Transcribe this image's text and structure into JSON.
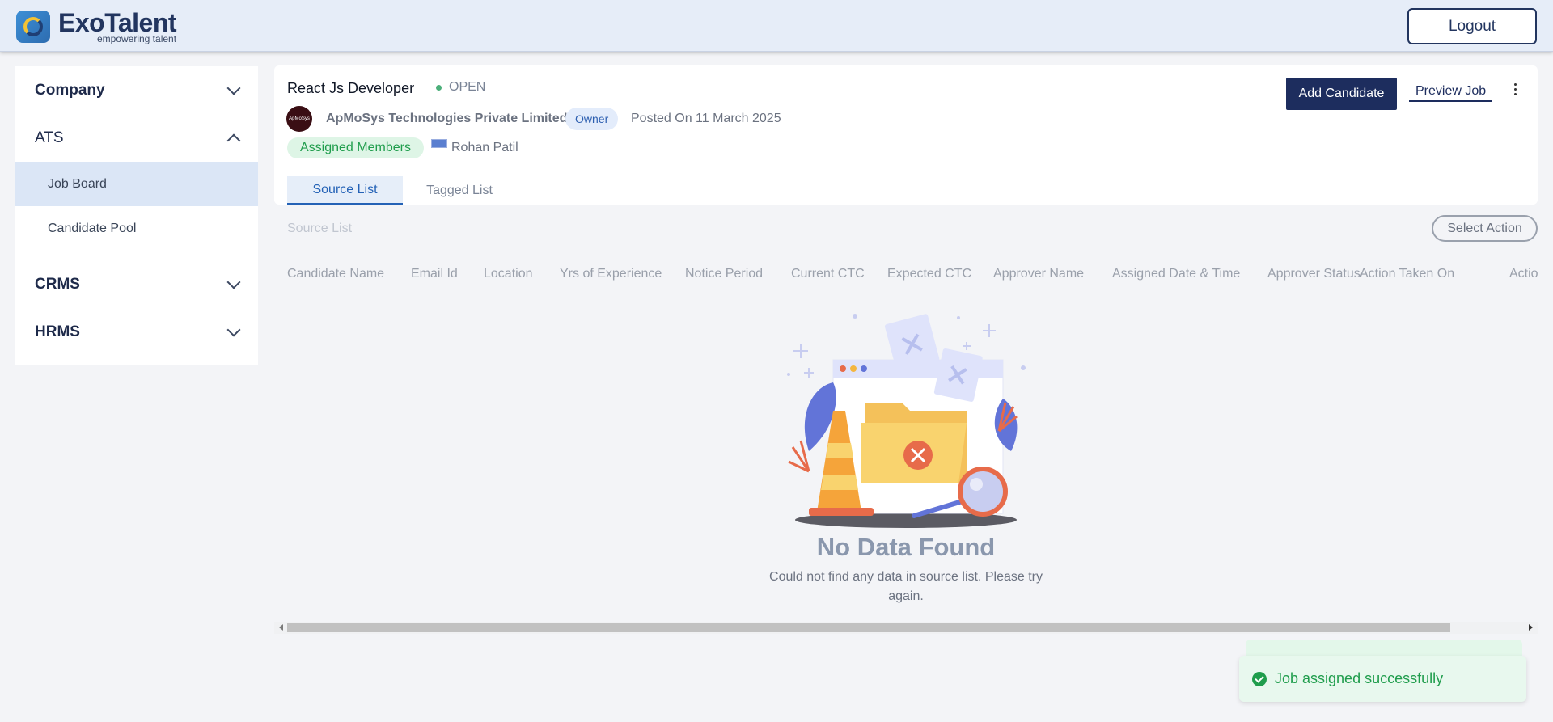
{
  "header": {
    "brand_name": "ExoTalent",
    "brand_tagline": "empowering talent",
    "logout_label": "Logout"
  },
  "sidebar": {
    "groups": [
      {
        "label": "Company",
        "expanded": false
      },
      {
        "label": "ATS",
        "expanded": true,
        "items": [
          {
            "label": "Job Board",
            "active": true
          },
          {
            "label": "Candidate Pool",
            "active": false
          }
        ]
      },
      {
        "label": "CRMS",
        "expanded": false
      },
      {
        "label": "HRMS",
        "expanded": false
      }
    ]
  },
  "job": {
    "title": "React Js Developer",
    "status": "OPEN",
    "company_logo_text": "ApMoSys",
    "company_name": "ApMoSys Technologies Private Limited",
    "owner_badge": "Owner",
    "posted": "Posted On 11 March 2025",
    "members_label": "Assigned Members",
    "member_name": "Rohan Patil",
    "add_candidate_label": "Add Candidate",
    "preview_job_label": "Preview Job",
    "tabs": [
      {
        "label": "Source List",
        "active": true
      },
      {
        "label": "Tagged List",
        "active": false
      }
    ]
  },
  "source_list": {
    "label": "Source List",
    "select_action_label": "Select Action",
    "columns": [
      "Candidate Name",
      "Email Id",
      "Location",
      "Yrs of Experience",
      "Notice Period",
      "Current CTC",
      "Expected CTC",
      "Approver Name",
      "Assigned Date & Time",
      "Approver Status",
      "Action Taken On",
      "Actio"
    ]
  },
  "empty_state": {
    "title": "No Data Found",
    "message": "Could not find any data in source list. Please try again."
  },
  "toast": {
    "message": "Job assigned successfully",
    "color": "#1f9d4c"
  },
  "colors": {
    "primary": "#1d2d5e",
    "active_tab": "#2462b6",
    "success": "#1f9d4c",
    "sidebar_active": "#dbe6f6"
  }
}
